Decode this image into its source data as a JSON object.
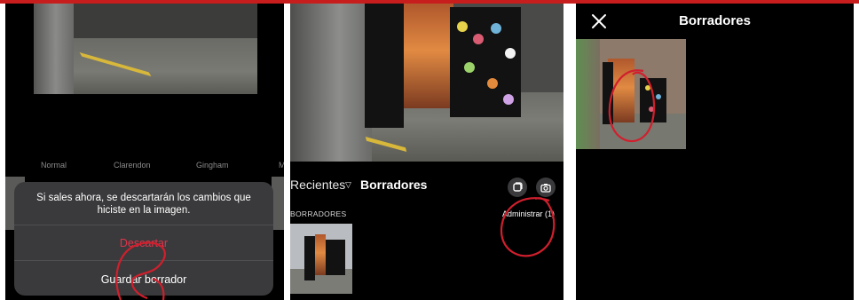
{
  "screen_left": {
    "filter_labels": [
      "Normal",
      "Clarendon",
      "Gingham",
      "M"
    ],
    "dialog": {
      "message": "Si sales ahora, se descartarán los cambios que hiciste en la imagen.",
      "discard_label": "Descartar",
      "save_draft_label": "Guardar borrador"
    }
  },
  "screen_middle": {
    "album_label": "Recientes",
    "drafts_label": "Borradores",
    "section_label": "BORRADORES",
    "manage_label": "Administrar (1)",
    "icons": [
      "multi-select-icon",
      "camera-icon"
    ]
  },
  "screen_right": {
    "title": "Borradores",
    "close_icon": "close-icon"
  },
  "colors": {
    "background": "#000000",
    "dialog_bg": "#3a3a3c",
    "danger": "#e0344b",
    "annotation": "#d11f2d",
    "top_accent": "#c81d1d"
  }
}
